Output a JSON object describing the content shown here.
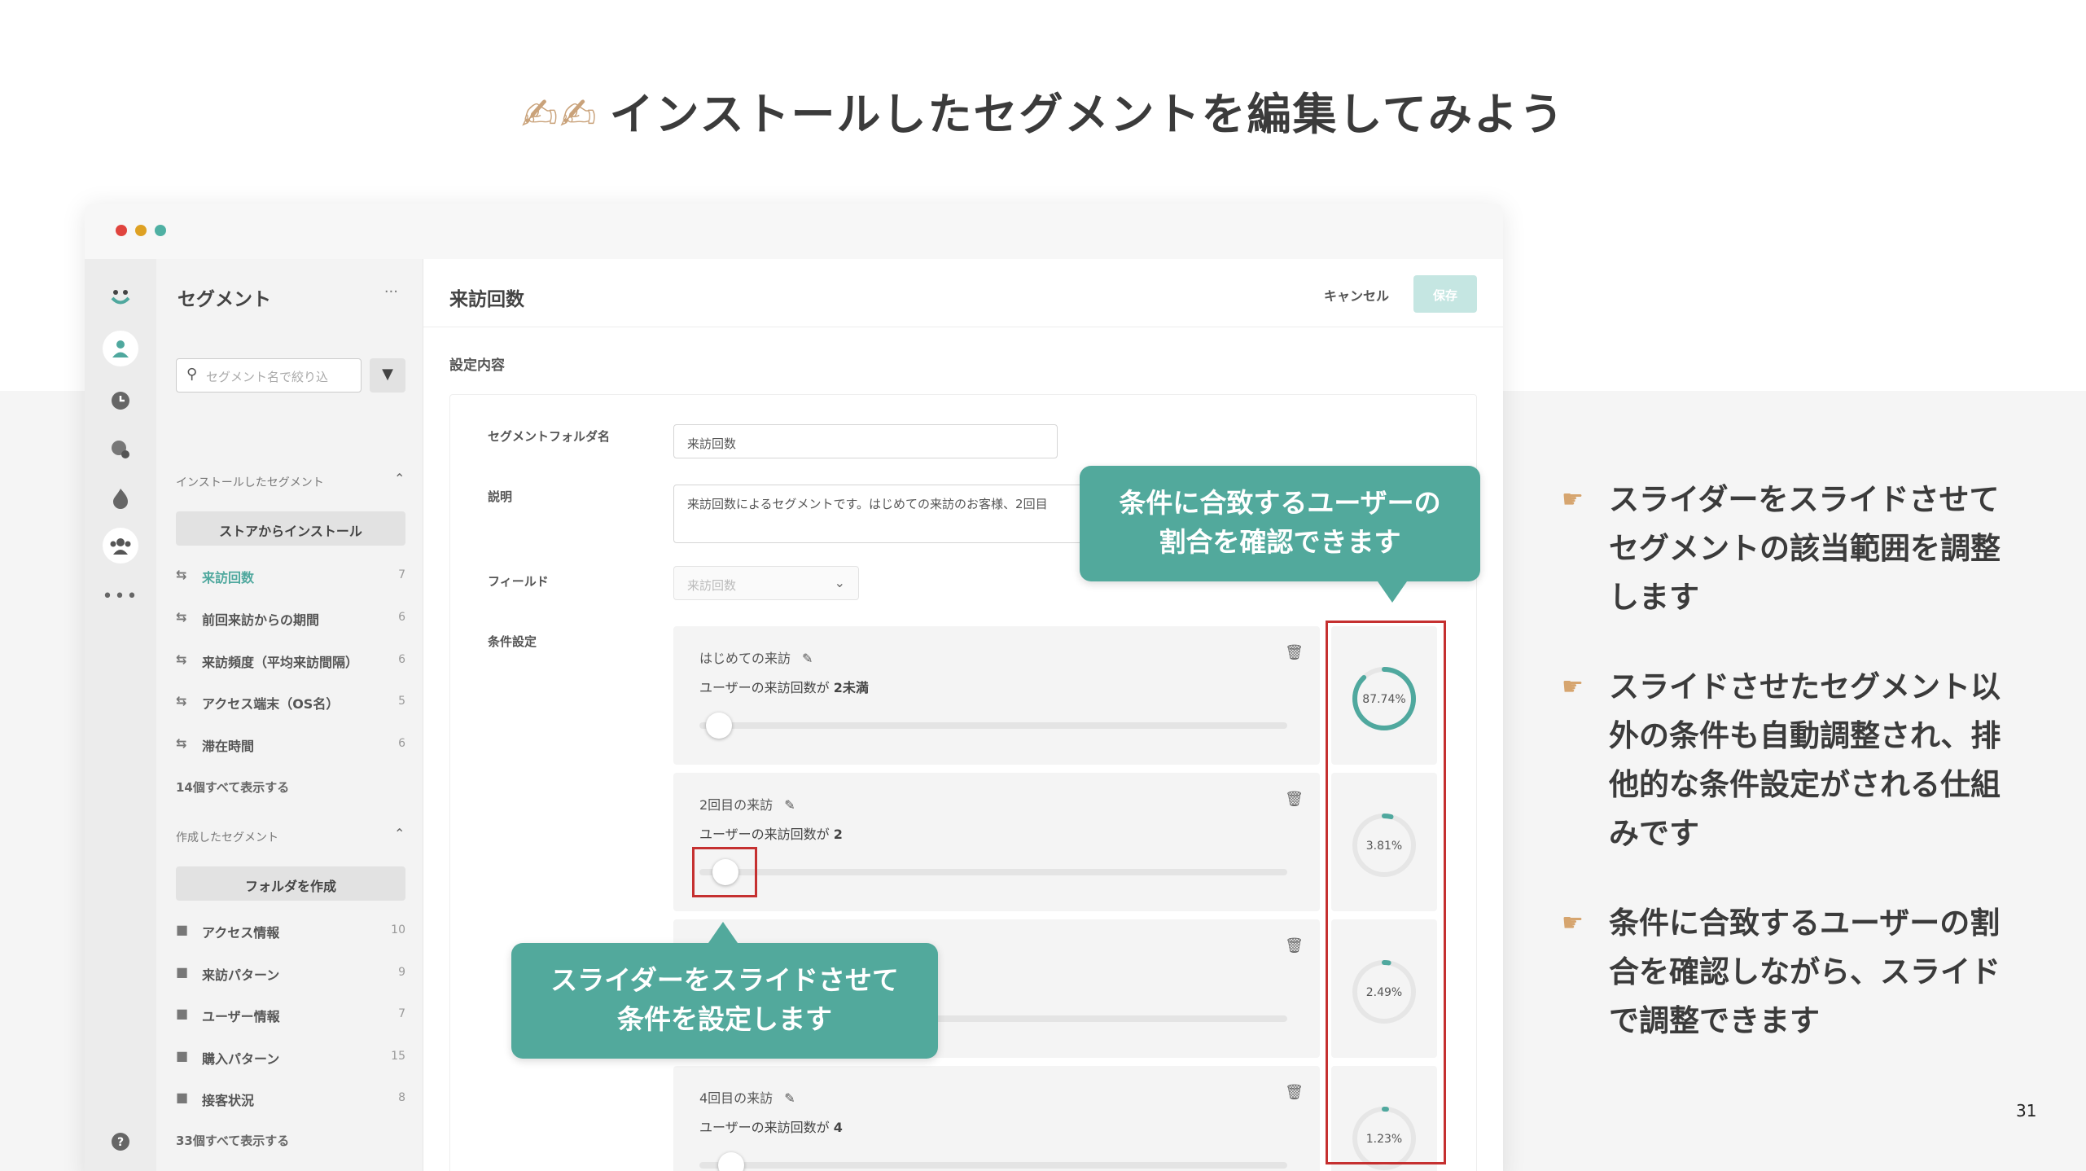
{
  "slide": {
    "title_icon": "writing-hand-icon",
    "title": "インストールしたセグメントを編集してみよう",
    "page_number": "31"
  },
  "window": {
    "traffic_lights": [
      "#e0443e",
      "#dea123",
      "#4fb0a3"
    ]
  },
  "sidebar": {
    "title": "セグメント",
    "more": "···",
    "search_placeholder": "セグメント名で絞り込",
    "installed_section": "インストールしたセグメント",
    "store_button": "ストアからインストール",
    "installed_items": [
      {
        "label": "来訪回数",
        "count": "7",
        "active": true
      },
      {
        "label": "前回来訪からの期間",
        "count": "6"
      },
      {
        "label": "来訪頻度（平均来訪間隔）",
        "count": "6"
      },
      {
        "label": "アクセス端末（OS名）",
        "count": "5"
      },
      {
        "label": "滞在時間",
        "count": "6"
      }
    ],
    "installed_show_all": "14個すべて表示する",
    "created_section": "作成したセグメント",
    "create_folder_button": "フォルダを作成",
    "folders": [
      {
        "label": "アクセス情報",
        "count": "10"
      },
      {
        "label": "来訪パターン",
        "count": "9"
      },
      {
        "label": "ユーザー情報",
        "count": "7"
      },
      {
        "label": "購入パターン",
        "count": "15"
      },
      {
        "label": "接客状況",
        "count": "8"
      }
    ],
    "folders_show_all": "33個すべて表示する"
  },
  "main": {
    "title": "来訪回数",
    "cancel": "キャンセル",
    "save": "保存",
    "settings_label": "設定内容",
    "folder_name_label": "セグメントフォルダ名",
    "folder_name_value": "来訪回数",
    "description_label": "説明",
    "description_value": "来訪回数によるセグメントです。はじめての来訪のお客様、2回目",
    "field_label": "フィールド",
    "field_value": "来訪回数",
    "conditions_label": "条件設定",
    "conditions": [
      {
        "title": "はじめての来訪",
        "desc_prefix": "ユーザーの来訪回数が ",
        "desc_value": "2未満",
        "slider": 0.02,
        "ratio_label": "87.74%",
        "ratio": 0.8774
      },
      {
        "title": "2回目の来訪",
        "desc_prefix": "ユーザーの来訪回数が ",
        "desc_value": "2",
        "slider": 0.03,
        "ratio_label": "3.81%",
        "ratio": 0.0381
      },
      {
        "title": "",
        "desc_prefix": "",
        "desc_value": "",
        "slider": null,
        "ratio_label": "2.49%",
        "ratio": 0.0249
      },
      {
        "title": "4回目の来訪",
        "desc_prefix": "ユーザーの来訪回数が ",
        "desc_value": "4",
        "slider": 0.04,
        "ratio_label": "1.23%",
        "ratio": 0.0123
      }
    ]
  },
  "callouts": {
    "ratio_line1": "条件に合致するユーザーの",
    "ratio_line2": "割合を確認できます",
    "slider_line1": "スライダーをスライドさせて",
    "slider_line2": "条件を設定します"
  },
  "bullets": [
    {
      "icon": "pointing-hand-icon",
      "lines": [
        "スライダーをスライドさせて",
        "セグメントの該当範囲を調整",
        "します"
      ]
    },
    {
      "icon": "pointing-hand-icon",
      "lines": [
        "スライドさせたセグメント以",
        "外の条件も自動調整され、排",
        "他的な条件設定がされる仕組",
        "みです"
      ]
    },
    {
      "icon": "pointing-hand-icon",
      "lines": [
        "条件に合致するユーザーの割",
        "合を確認しながら、スライド",
        "で調整できます"
      ]
    }
  ],
  "colors": {
    "accent": "#4fa89e",
    "callout": "#52a99c",
    "highlight": "#c53030"
  }
}
